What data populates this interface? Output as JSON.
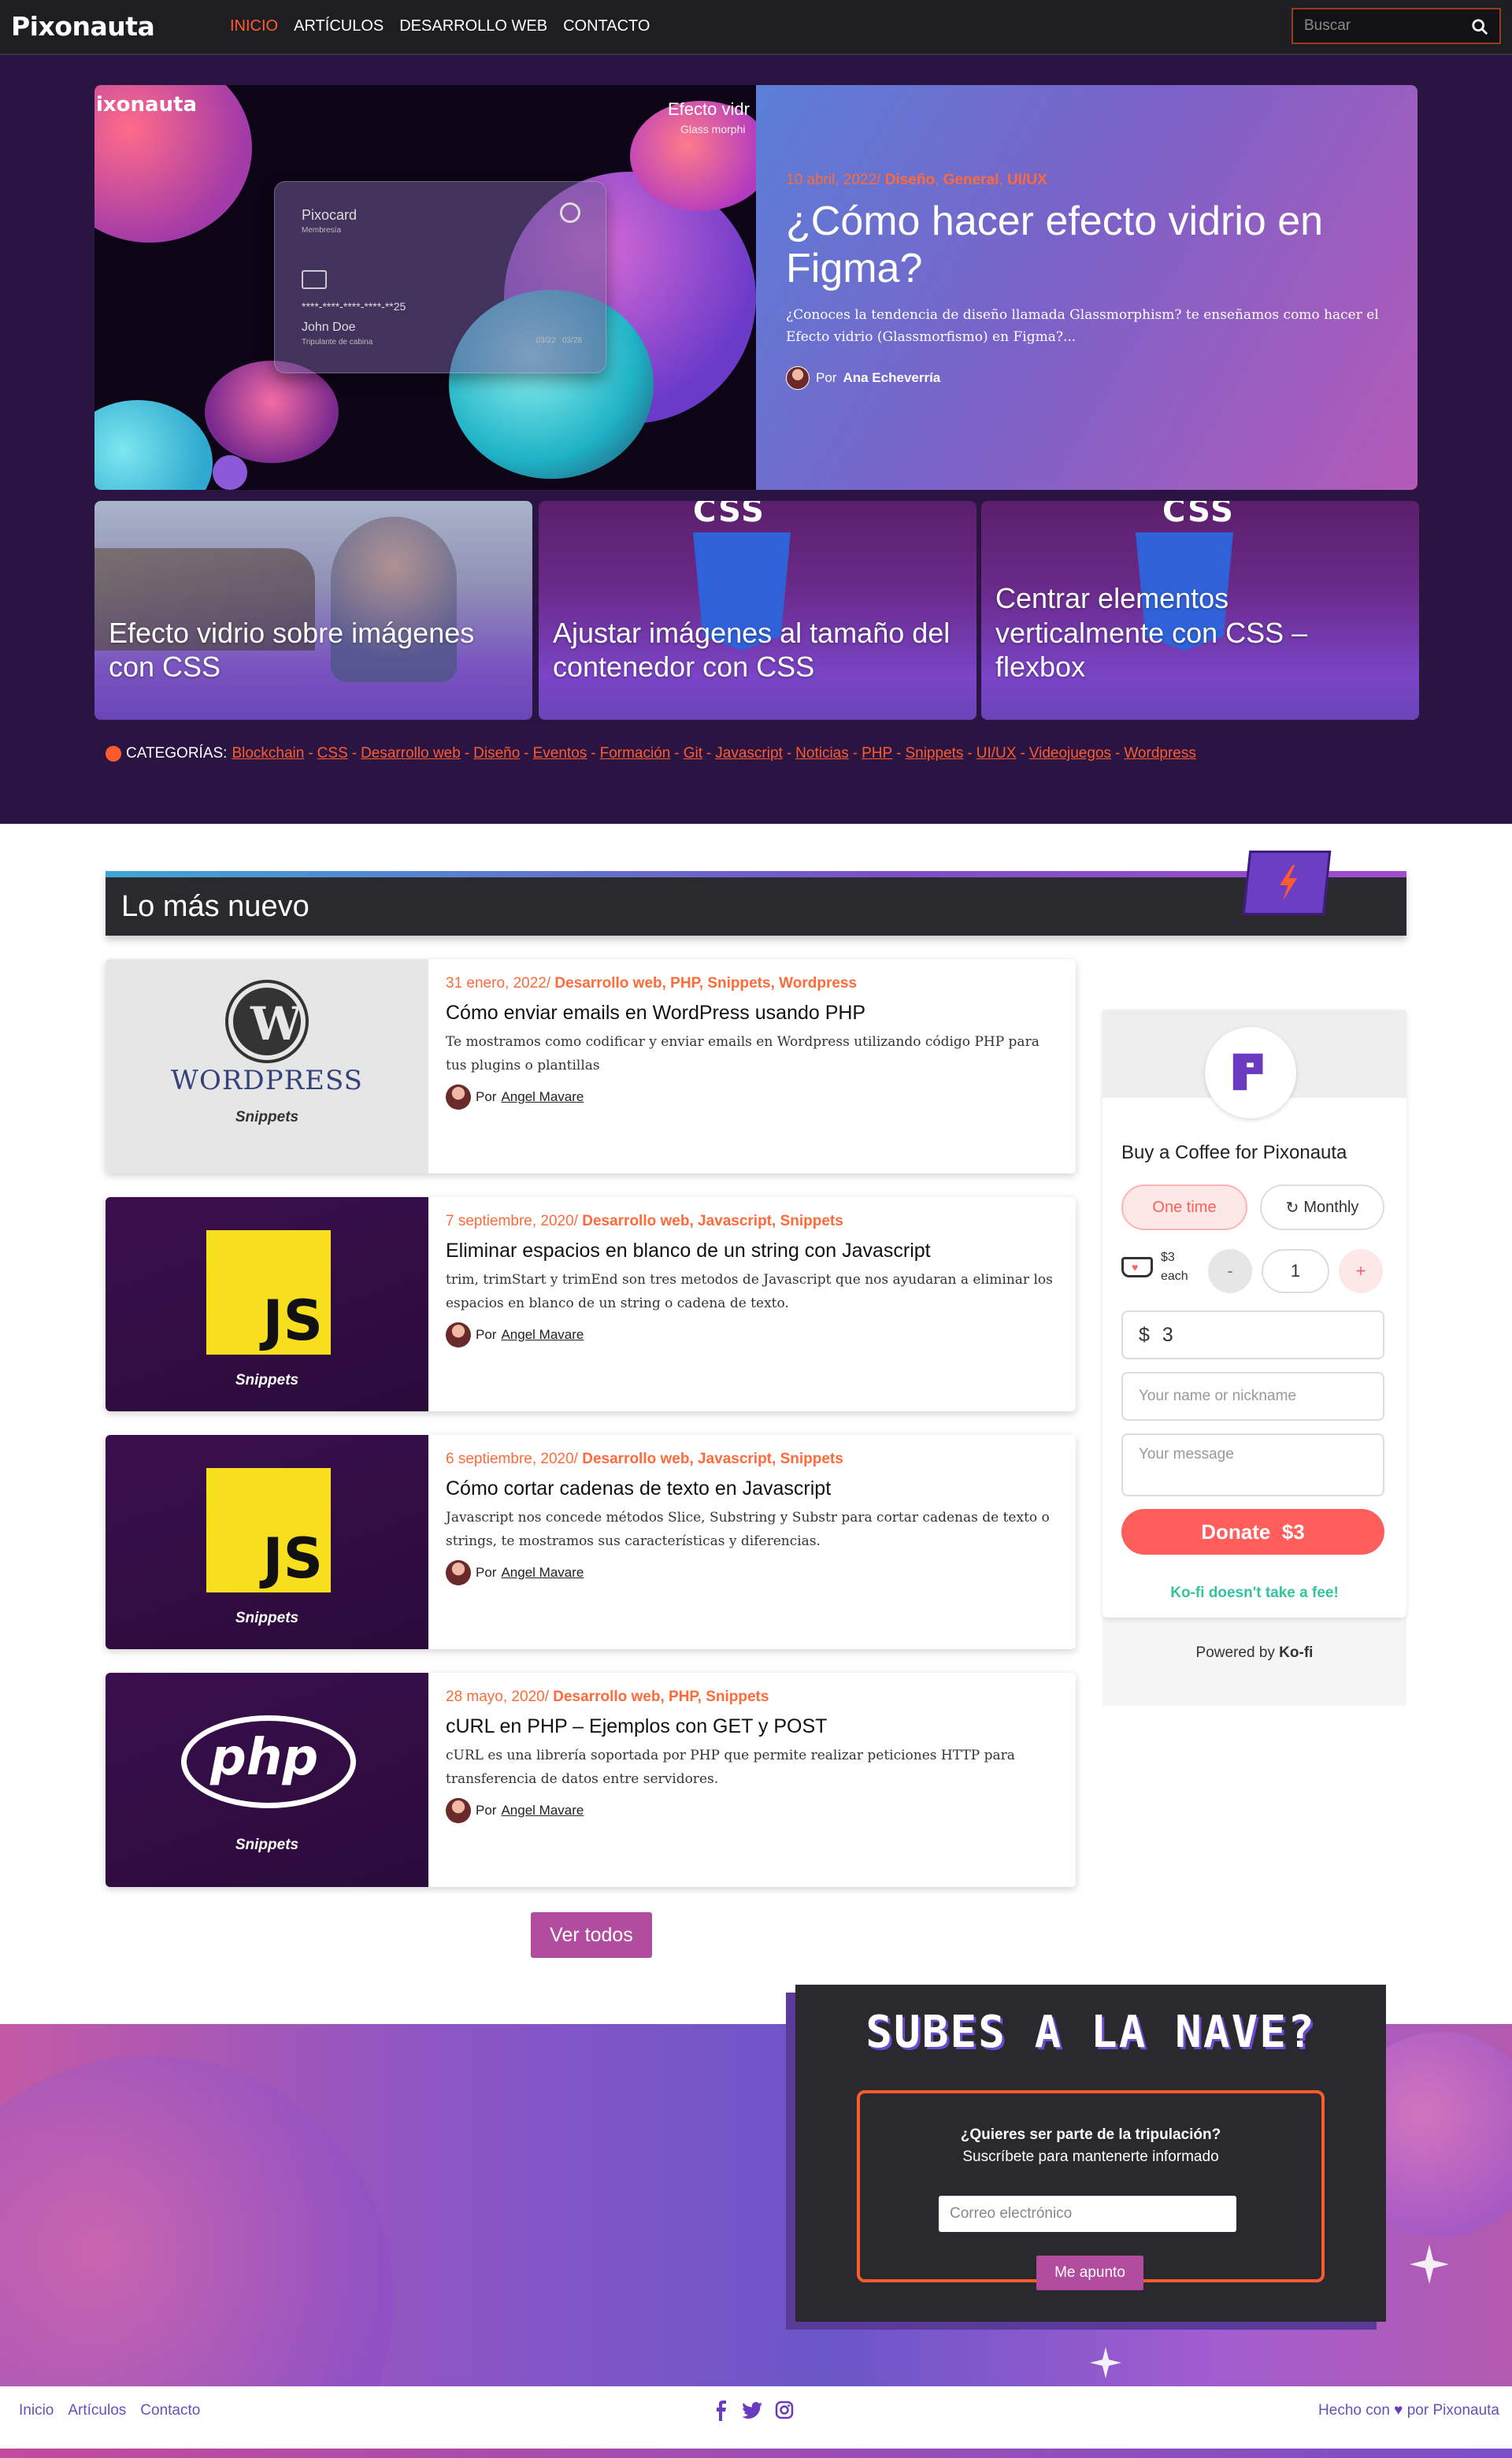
{
  "nav": {
    "logo": "Pixonauta",
    "items": [
      {
        "label": "INICIO",
        "active": true
      },
      {
        "label": "ARTÍCULOS",
        "active": false
      },
      {
        "label": "DESARROLLO WEB",
        "active": false
      },
      {
        "label": "CONTACTO",
        "active": false
      }
    ],
    "search_placeholder": "Buscar"
  },
  "featured": {
    "image_brand": "ixonauta",
    "image_caption": "Efecto vidr",
    "image_caption_sub": "Glass morphi",
    "card_brand": "Pixocard",
    "card_sub": "Membresía",
    "card_number": "****-****-****-****-**25",
    "card_name": "John Doe",
    "card_role": "Tripulante de cabina",
    "card_dates": "03/22   03/28",
    "date": "10 abril, 2022/",
    "categories": [
      "Diseño",
      "General",
      "UI/UX"
    ],
    "title": "¿Cómo hacer efecto vidrio en Figma?",
    "excerpt": "¿Conoces la tendencia de diseño llamada Glassmorphism? te enseñamos como hacer el Efecto vidrio (Glassmorfismo) en Figma?...",
    "by": "Por",
    "author": "Ana Echeverría"
  },
  "small_cards": [
    {
      "title": "Efecto vidrio sobre imágenes con CSS"
    },
    {
      "title": "Ajustar imágenes al tamaño del contenedor con CSS"
    },
    {
      "title": "Centrar elementos verticalmente con CSS – flexbox"
    }
  ],
  "categories": {
    "label": "CATEGORÍAS:",
    "items": [
      "Blockchain",
      "CSS",
      "Desarrollo web",
      "Diseño",
      "Eventos",
      "Formación",
      "Git",
      "Javascript",
      "Noticias",
      "PHP",
      "Snippets",
      "UI/UX",
      "Videojuegos",
      "Wordpress"
    ]
  },
  "newest": {
    "heading": "Lo más nuevo",
    "posts": [
      {
        "date": "31 enero, 2022/",
        "cats": "Desarrollo web, PHP, Snippets, Wordpress",
        "title": "Cómo enviar emails en WordPress usando PHP",
        "excerpt": "Te mostramos como codificar y enviar emails en Wordpress utilizando código PHP para tus plugins o plantillas",
        "by": "Por",
        "author": "Angel Mavare",
        "image": "WORDPRESS",
        "badge": "Snippets"
      },
      {
        "date": "7 septiembre, 2020/",
        "cats": "Desarrollo web, Javascript, Snippets",
        "title": "Eliminar espacios en blanco de un string con Javascript",
        "excerpt": "trim, trimStart y trimEnd son tres metodos de Javascript que nos ayudaran a eliminar los espacios en blanco de un string o cadena de texto.",
        "by": "Por",
        "author": "Angel Mavare",
        "image": "JS",
        "badge": "Snippets"
      },
      {
        "date": "6 septiembre, 2020/",
        "cats": "Desarrollo web, Javascript, Snippets",
        "title": "Cómo cortar cadenas de texto en Javascript",
        "excerpt": "Javascript nos concede métodos Slice, Substring y Substr para cortar cadenas de texto o strings, te mostramos sus características y diferencias.",
        "by": "Por",
        "author": "Angel Mavare",
        "image": "JS",
        "badge": "Snippets"
      },
      {
        "date": "28 mayo, 2020/",
        "cats": "Desarrollo web, PHP, Snippets",
        "title": "cURL en PHP – Ejemplos con GET y POST",
        "excerpt": "cURL es una librería soportada por PHP que permite realizar peticiones HTTP para transferencia de datos entre servidores.",
        "by": "Por",
        "author": "Angel Mavare",
        "image": "php",
        "badge": "Snippets"
      }
    ],
    "more_label": "Ver todos"
  },
  "kofi": {
    "title": "Buy a Coffee for Pixonauta",
    "one_time": "One time",
    "monthly": "Monthly",
    "price": "$3",
    "each": "each",
    "minus": "-",
    "qty": "1",
    "plus": "+",
    "currency": "$",
    "amount": "3",
    "name_placeholder": "Your name or nickname",
    "message_placeholder": "Your message",
    "donate": "Donate  $3",
    "no_fee": "Ko-fi doesn't take a fee!",
    "powered_prefix": "Powered by",
    "powered_brand": "Ko-fi"
  },
  "newsletter": {
    "title": "SUBES A LA NAVE?",
    "question": "¿Quieres ser parte de la tripulación?",
    "subtitle": "Suscríbete para mantenerte informado",
    "email_placeholder": "Correo electrónico",
    "button": "Me apunto"
  },
  "footer": {
    "links": [
      "Inicio",
      "Artículos",
      "Contacto"
    ],
    "made_prefix": "Hecho con",
    "made_by": "por",
    "brand": "Pixonauta",
    "social_icons": [
      "facebook-icon",
      "twitter-icon",
      "instagram-icon"
    ]
  },
  "colors": {
    "accent": "#ff5b2c",
    "purple": "#7b4fc9",
    "kofi_red": "#ff5e5b"
  }
}
